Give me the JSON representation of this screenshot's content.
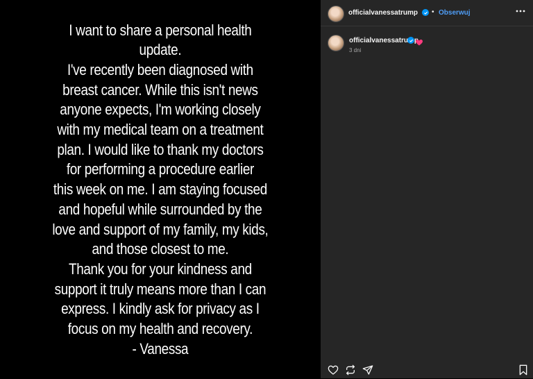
{
  "post": {
    "lines": [
      "I want to share a personal health",
      "update.",
      "I've recently been diagnosed with",
      "breast cancer. While this isn't news",
      "anyone expects, I'm working closely",
      "with my medical team on a treatment",
      "plan. I would like to thank my doctors",
      "for performing a procedure earlier",
      "this week on me. I am staying focused",
      "and hopeful while surrounded by the",
      "love and support of my family, my kids,",
      "and those closest to me.",
      "Thank you for your kindness and",
      "support it truly means more than I can",
      "express. I kindly ask for privacy as I",
      "focus on my health and recovery.",
      "- Vanessa"
    ]
  },
  "header": {
    "username": "officialvanessatrump",
    "separator": "•",
    "follow_label": "Obserwuj",
    "more_icon": "more-horizontal-icon"
  },
  "caption": {
    "username": "officialvanessatrump",
    "emoji": "pink-heart",
    "emoji_color": "#ff3b7f",
    "time": "3 dni"
  },
  "actions": {
    "like_icon": "heart-outline-icon",
    "repost_icon": "repost-icon",
    "share_icon": "send-icon",
    "save_icon": "bookmark-icon"
  },
  "colors": {
    "panel_bg": "#262626",
    "verified": "#0095f6",
    "follow": "#4f9ef8",
    "text": "#f5f5f5",
    "muted": "#a8a8a8"
  }
}
